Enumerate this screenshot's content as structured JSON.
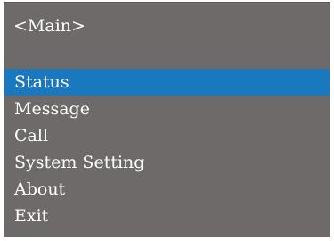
{
  "screen": {
    "title": "<Main>",
    "selected_index": 0,
    "highlight_color": "#1a78bf",
    "background_color": "#6e6a69"
  },
  "menu": {
    "items": [
      {
        "label": "Status"
      },
      {
        "label": "Message"
      },
      {
        "label": "Call"
      },
      {
        "label": "System Setting"
      },
      {
        "label": "About"
      },
      {
        "label": "Exit"
      }
    ]
  }
}
